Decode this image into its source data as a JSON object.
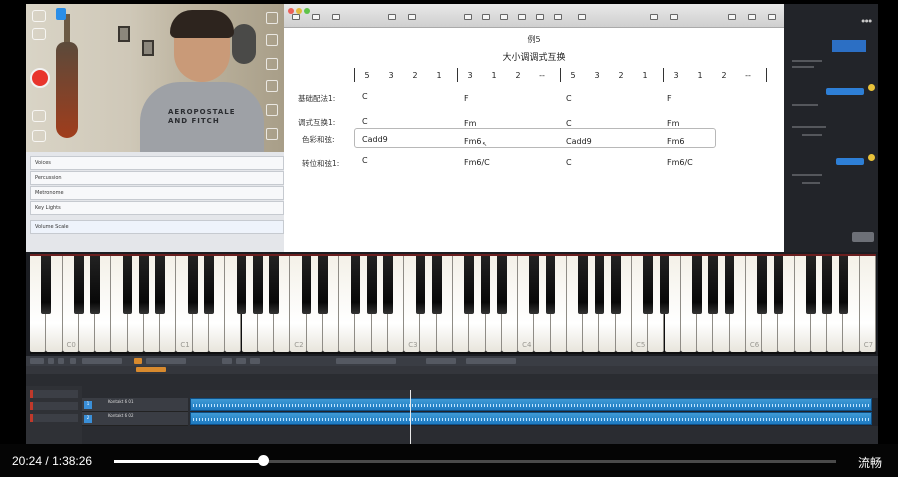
{
  "score": {
    "example_no": "例5",
    "title": "大小调调式互换",
    "beats": [
      [
        "5",
        "3",
        "2",
        "1"
      ],
      [
        "3",
        "1",
        "2",
        "--"
      ],
      [
        "5",
        "3",
        "2",
        "1"
      ],
      [
        "3",
        "1",
        "2",
        "--"
      ]
    ],
    "rows": [
      {
        "label": "基础配法1:",
        "chords": [
          "C",
          "F",
          "C",
          "F"
        ]
      },
      {
        "label": "调式互换1:",
        "chords": [
          "C",
          "Fm",
          "C",
          "Fm"
        ]
      },
      {
        "label": "色彩和弦:",
        "chords": [
          "Cadd9",
          "Fm6",
          "Cadd9",
          "Fm6"
        ]
      },
      {
        "label": "转位和弦1:",
        "chords": [
          "C",
          "Fm6/C",
          "C",
          "Fm6/C"
        ]
      }
    ]
  },
  "tracks": {
    "items": [
      "Voices",
      "Percussion",
      "Metronome",
      "Key Lights",
      "Volume Scale"
    ]
  },
  "piano": {
    "octave_labels": [
      "C0",
      "C1",
      "C2",
      "C3",
      "C4",
      "C5",
      "C6",
      "C7"
    ]
  },
  "daw": {
    "track1": "Kontakt 6 01",
    "track2": "Kontakt 6 02"
  },
  "player": {
    "current_time": "20:24",
    "separator": "/",
    "total_time": "1:38:26",
    "progress": 0.207,
    "quality_label": "流畅"
  },
  "colors": {
    "accent": "#2e7fd6",
    "record": "#e8342c"
  }
}
